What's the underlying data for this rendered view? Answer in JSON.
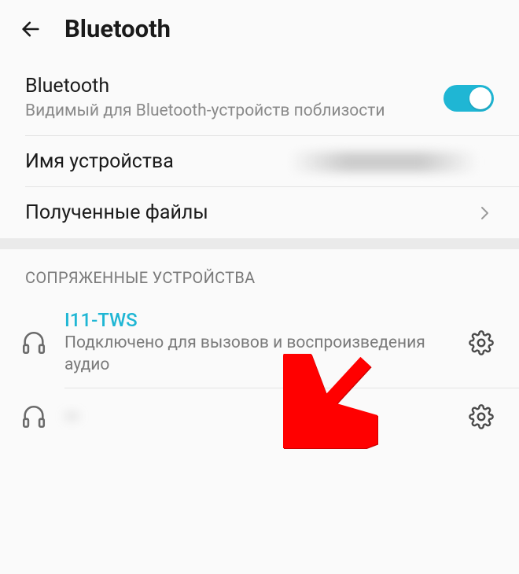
{
  "header": {
    "title": "Bluetooth"
  },
  "bluetooth_toggle": {
    "title": "Bluetooth",
    "subtitle": "Видимый для Bluetooth-устройств поблизости",
    "enabled": true
  },
  "device_name": {
    "label": "Имя устройства",
    "value": ""
  },
  "received_files": {
    "label": "Полученные файлы"
  },
  "paired_section": {
    "header": "СОПРЯЖЕННЫЕ УСТРОЙСТВА"
  },
  "devices": [
    {
      "name": "I11-TWS",
      "status": "Подключено для вызовов и воспроизведения аудио",
      "connected": true
    },
    {
      "name": "—",
      "status": "",
      "connected": false
    }
  ],
  "colors": {
    "accent": "#1fb6d4",
    "annotation": "#ff0000"
  }
}
